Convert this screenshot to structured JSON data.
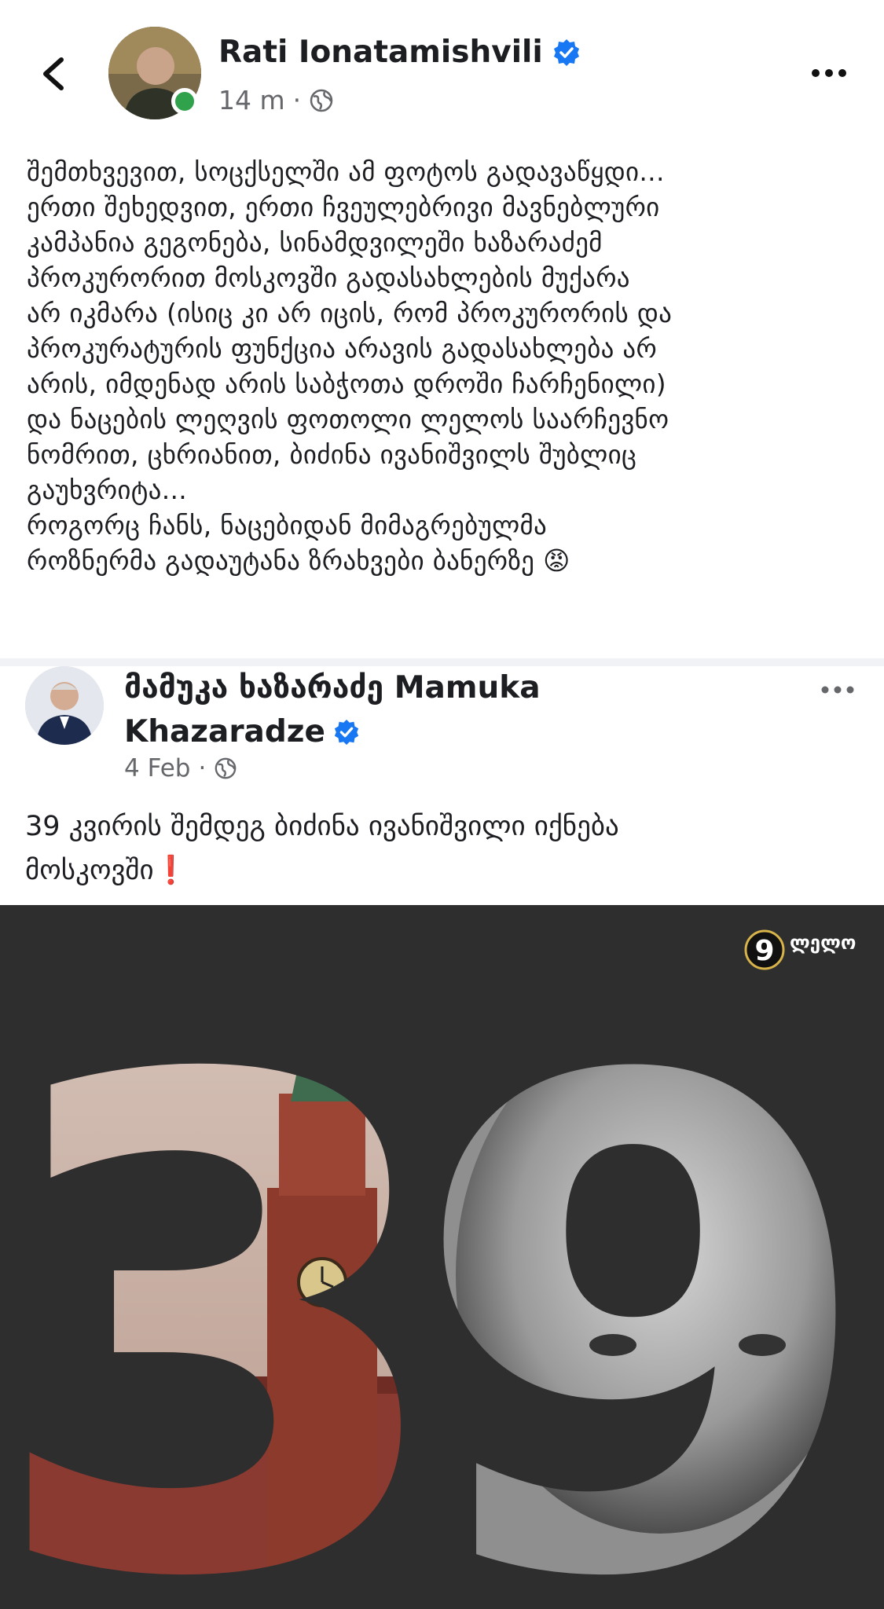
{
  "post": {
    "author": "Rati Ionatamishvili",
    "time": "14 m",
    "separator": "·",
    "text_lines": [
      "შემთხვევით, სოცქსელში ამ ფოტოს გადავაწყდი...",
      "ერთი შეხედვით, ერთი ჩვეულებრივი მავნებლური",
      "კამპანია გეგონება, სინამდვილეში ხაზარაძემ",
      "პროკურორით მოსკოვში გადასახლების მუქარა",
      "არ იკმარა (ისიც კი არ იცის, რომ პროკურორის და",
      "პროკურატურის ფუნქცია არავის გადასახლება არ",
      "არის, იმდენად არის საბჭოთა დროში ჩარჩენილი)",
      "და ნაცების ლეღვის ფოთოლი ლელოს საარჩევნო",
      "ნომრით, ცხრიანით, ბიძინა ივანიშვილს შუბლიც",
      "გაუხვრიტა...",
      "როგორც ჩანს, ნაცებიდან მიმაგრებულმა",
      "როზნერმა გადაუტანა ზრახვები ბანერზე"
    ],
    "emoji": "😡"
  },
  "shared_post": {
    "author_line1": "მამუკა ხაზარაძე Mamuka",
    "author_line2": "Khazaradze",
    "date": "4 Feb",
    "separator": "·",
    "text_line1": "39 კვირის შემდეგ ბიძინა ივანიშვილი იქნება",
    "text_line2": "მოსკოვში",
    "exclamation": "❗"
  },
  "banner": {
    "big_number": "39",
    "logo_number": "9",
    "logo_text": "ლელო"
  },
  "colors": {
    "verified": "#1877f2",
    "online": "#31a24c",
    "meta": "#65676b",
    "banner_bg": "#2e2e2e"
  },
  "icons": [
    "chevron-left-icon",
    "verified-badge-icon",
    "globe-icon",
    "more-horizontal-icon"
  ]
}
